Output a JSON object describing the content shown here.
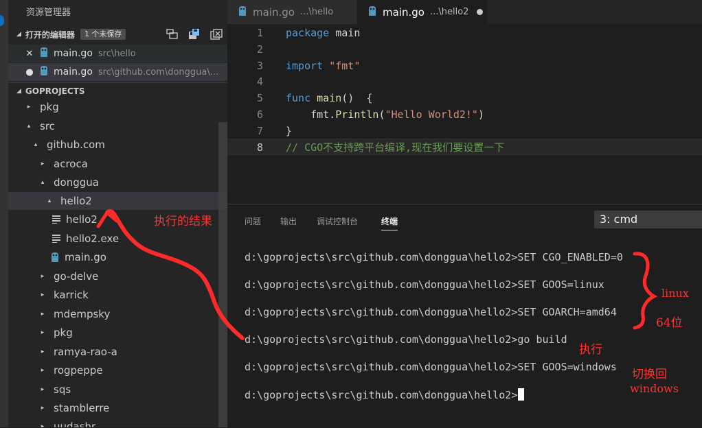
{
  "sidebar": {
    "title": "资源管理器",
    "open_editors": {
      "header": "打开的编辑器",
      "badge": "1 个未保存",
      "items": [
        {
          "mark": "✕",
          "name": "main.go",
          "path": "src\\hello"
        },
        {
          "mark": "●",
          "name": "main.go",
          "path": "src\\github.com\\donggua\\..."
        }
      ]
    },
    "project": {
      "header": "GOPROJECTS",
      "tree": [
        {
          "label": "pkg",
          "twisty": "▸"
        },
        {
          "label": "src",
          "twisty": "▴"
        },
        {
          "label": "github.com",
          "twisty": "▴"
        },
        {
          "label": "acroca",
          "twisty": "▸"
        },
        {
          "label": "donggua",
          "twisty": "▴"
        },
        {
          "label": "hello2",
          "twisty": "▴"
        },
        {
          "label": "hello2",
          "icon": "file-lines-icon"
        },
        {
          "label": "hello2.exe",
          "icon": "file-lines-icon"
        },
        {
          "label": "main.go",
          "icon": "go-gopher-icon"
        },
        {
          "label": "go-delve",
          "twisty": "▸"
        },
        {
          "label": "karrick",
          "twisty": "▸"
        },
        {
          "label": "mdempsky",
          "twisty": "▸"
        },
        {
          "label": "pkg",
          "twisty": "▸"
        },
        {
          "label": "ramya-rao-a",
          "twisty": "▸"
        },
        {
          "label": "rogpeppe",
          "twisty": "▸"
        },
        {
          "label": "sqs",
          "twisty": "▸"
        },
        {
          "label": "stamblerre",
          "twisty": "▸"
        },
        {
          "label": "uudashr",
          "twisty": "▸"
        }
      ]
    }
  },
  "tabs": [
    {
      "name": "main.go",
      "path": "...\\hello",
      "active": false
    },
    {
      "name": "main.go",
      "path": "...\\hello2",
      "active": true,
      "dirty": true
    }
  ],
  "editor": {
    "lines": [
      {
        "n": "1",
        "code": "package main"
      },
      {
        "n": "2",
        "code": ""
      },
      {
        "n": "3",
        "code": "import \"fmt\""
      },
      {
        "n": "4",
        "code": ""
      },
      {
        "n": "5",
        "code": "func main()  {"
      },
      {
        "n": "6",
        "code": "    fmt.Println(\"Hello World2!\")"
      },
      {
        "n": "7",
        "code": "}"
      },
      {
        "n": "8",
        "code": "// CGO不支持跨平台编译,现在我们要设置一下"
      }
    ]
  },
  "panel": {
    "tabs": [
      "问题",
      "输出",
      "调试控制台",
      "终端"
    ],
    "active_tab": "终端",
    "terminal_select": "3: cmd",
    "terminal_lines": [
      "d:\\goprojects\\src\\github.com\\donggua\\hello2>SET CGO_ENABLED=0",
      "d:\\goprojects\\src\\github.com\\donggua\\hello2>SET GOOS=linux",
      "d:\\goprojects\\src\\github.com\\donggua\\hello2>SET GOARCH=amd64",
      "d:\\goprojects\\src\\github.com\\donggua\\hello2>go build",
      "d:\\goprojects\\src\\github.com\\donggua\\hello2>SET GOOS=windows",
      "d:\\goprojects\\src\\github.com\\donggua\\hello2>"
    ]
  },
  "annotations": {
    "result": "执行的结果",
    "linux": "linux",
    "bits": "64位",
    "run": "执行",
    "switch_back_1": "切换回",
    "switch_back_2": "windows"
  },
  "colors": {
    "annotation": "#ff3333",
    "go_icon": "#519aba",
    "keyword": "#569cd6",
    "string": "#ce9178",
    "function": "#dcdcaa",
    "comment": "#6a9955"
  }
}
